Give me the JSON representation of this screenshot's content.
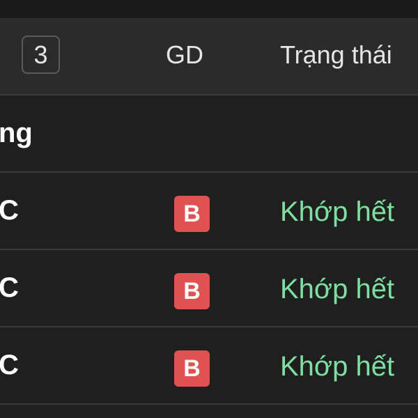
{
  "colors": {
    "background": "#1f1f1f",
    "header_background": "#2b2b2b",
    "divider": "#3a3a3a",
    "buy_badge": "#e05252",
    "status_matched": "#7ee0a0"
  },
  "header": {
    "count": "3",
    "side_column_label": "GD",
    "status_column_label": "Trạng thái"
  },
  "group": {
    "label": "ng"
  },
  "orders": [
    {
      "symbol": "C",
      "side": "B",
      "status": "Khớp hết"
    },
    {
      "symbol": "C",
      "side": "B",
      "status": "Khớp hết"
    },
    {
      "symbol": "C",
      "side": "B",
      "status": "Khớp hết"
    }
  ]
}
